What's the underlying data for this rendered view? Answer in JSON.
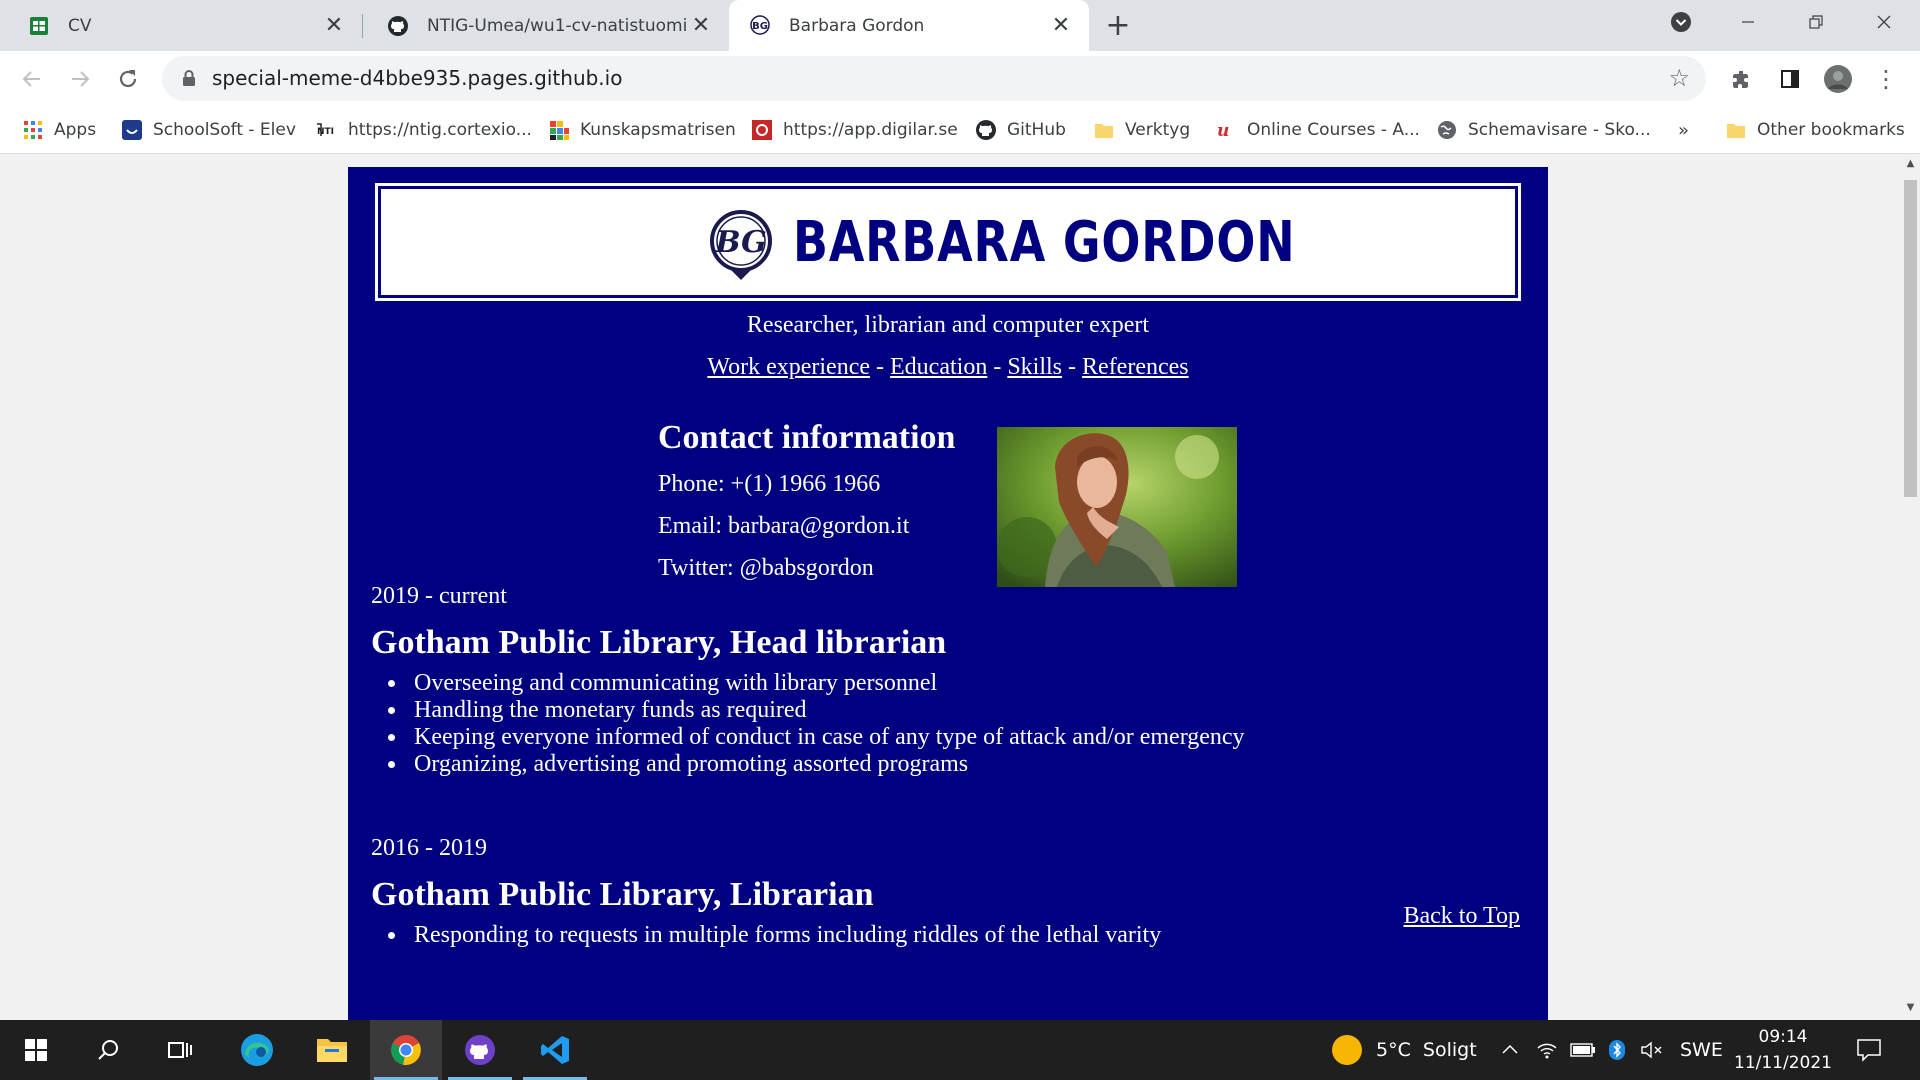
{
  "browser": {
    "tabs": [
      {
        "title": "CV",
        "icon": "google-sheets-icon"
      },
      {
        "title": "NTIG-Umea/wu1-cv-natistuomi:",
        "icon": "github-icon"
      },
      {
        "title": "Barbara Gordon",
        "icon": "bg-logo-icon",
        "active": true
      }
    ],
    "new_tab": "+",
    "url": "special-meme-d4bbe935.pages.github.io",
    "bookmarks": [
      {
        "label": "Apps",
        "icon": "apps-grid-icon"
      },
      {
        "label": "SchoolSoft - Elev",
        "icon": "schoolsoft-icon"
      },
      {
        "label": "https://ntig.cortexio...",
        "icon": "ntig-icon"
      },
      {
        "label": "Kunskapsmatrisen",
        "icon": "matrix-icon"
      },
      {
        "label": "https://app.digilar.se",
        "icon": "digilar-icon"
      },
      {
        "label": "GitHub",
        "icon": "github-icon"
      },
      {
        "label": "Verktyg",
        "icon": "folder-icon"
      },
      {
        "label": "Online Courses - A...",
        "icon": "udemy-icon"
      },
      {
        "label": "Schemavisare - Sko...",
        "icon": "globe-icon"
      }
    ],
    "more_bookmarks": "»",
    "other_bookmarks": "Other bookmarks"
  },
  "page": {
    "name": "BARBARA GORDON",
    "logo_text": "BG",
    "tagline": "Researcher, librarian and computer expert",
    "nav": {
      "work": "Work experience",
      "education": "Education",
      "skills": "Skills",
      "references": "References",
      "sep": "-"
    },
    "contact": {
      "heading": "Contact information",
      "phone": "Phone: +(1) 1966 1966",
      "email": "Email: barbara@gordon.it",
      "twitter": "Twitter: @babsgordon"
    },
    "jobs": [
      {
        "period": "2019 - current",
        "title": "Gotham Public Library, Head librarian",
        "duties": [
          "Overseeing and communicating with library personnel",
          "Handling the monetary funds as required",
          "Keeping everyone informed of conduct in case of any type of attack and/or emergency",
          "Organizing, advertising and promoting assorted programs"
        ]
      },
      {
        "period": "2016 - 2019",
        "title": "Gotham Public Library, Librarian",
        "duties": [
          "Responding to requests in multiple forms including riddles of the lethal varity"
        ]
      }
    ],
    "back_to_top": "Back to Top",
    "colors": {
      "background": "#000080",
      "text": "#ffffff",
      "header_box": "#ffffff"
    }
  },
  "taskbar": {
    "apps": [
      "windows-start-icon",
      "search-icon",
      "task-view-icon",
      "edge-icon",
      "file-explorer-icon",
      "chrome-icon",
      "github-desktop-icon",
      "vscode-icon"
    ],
    "weather": "5°C  Soligt",
    "language": "SWE",
    "time": "09:14",
    "date": "11/11/2021"
  }
}
